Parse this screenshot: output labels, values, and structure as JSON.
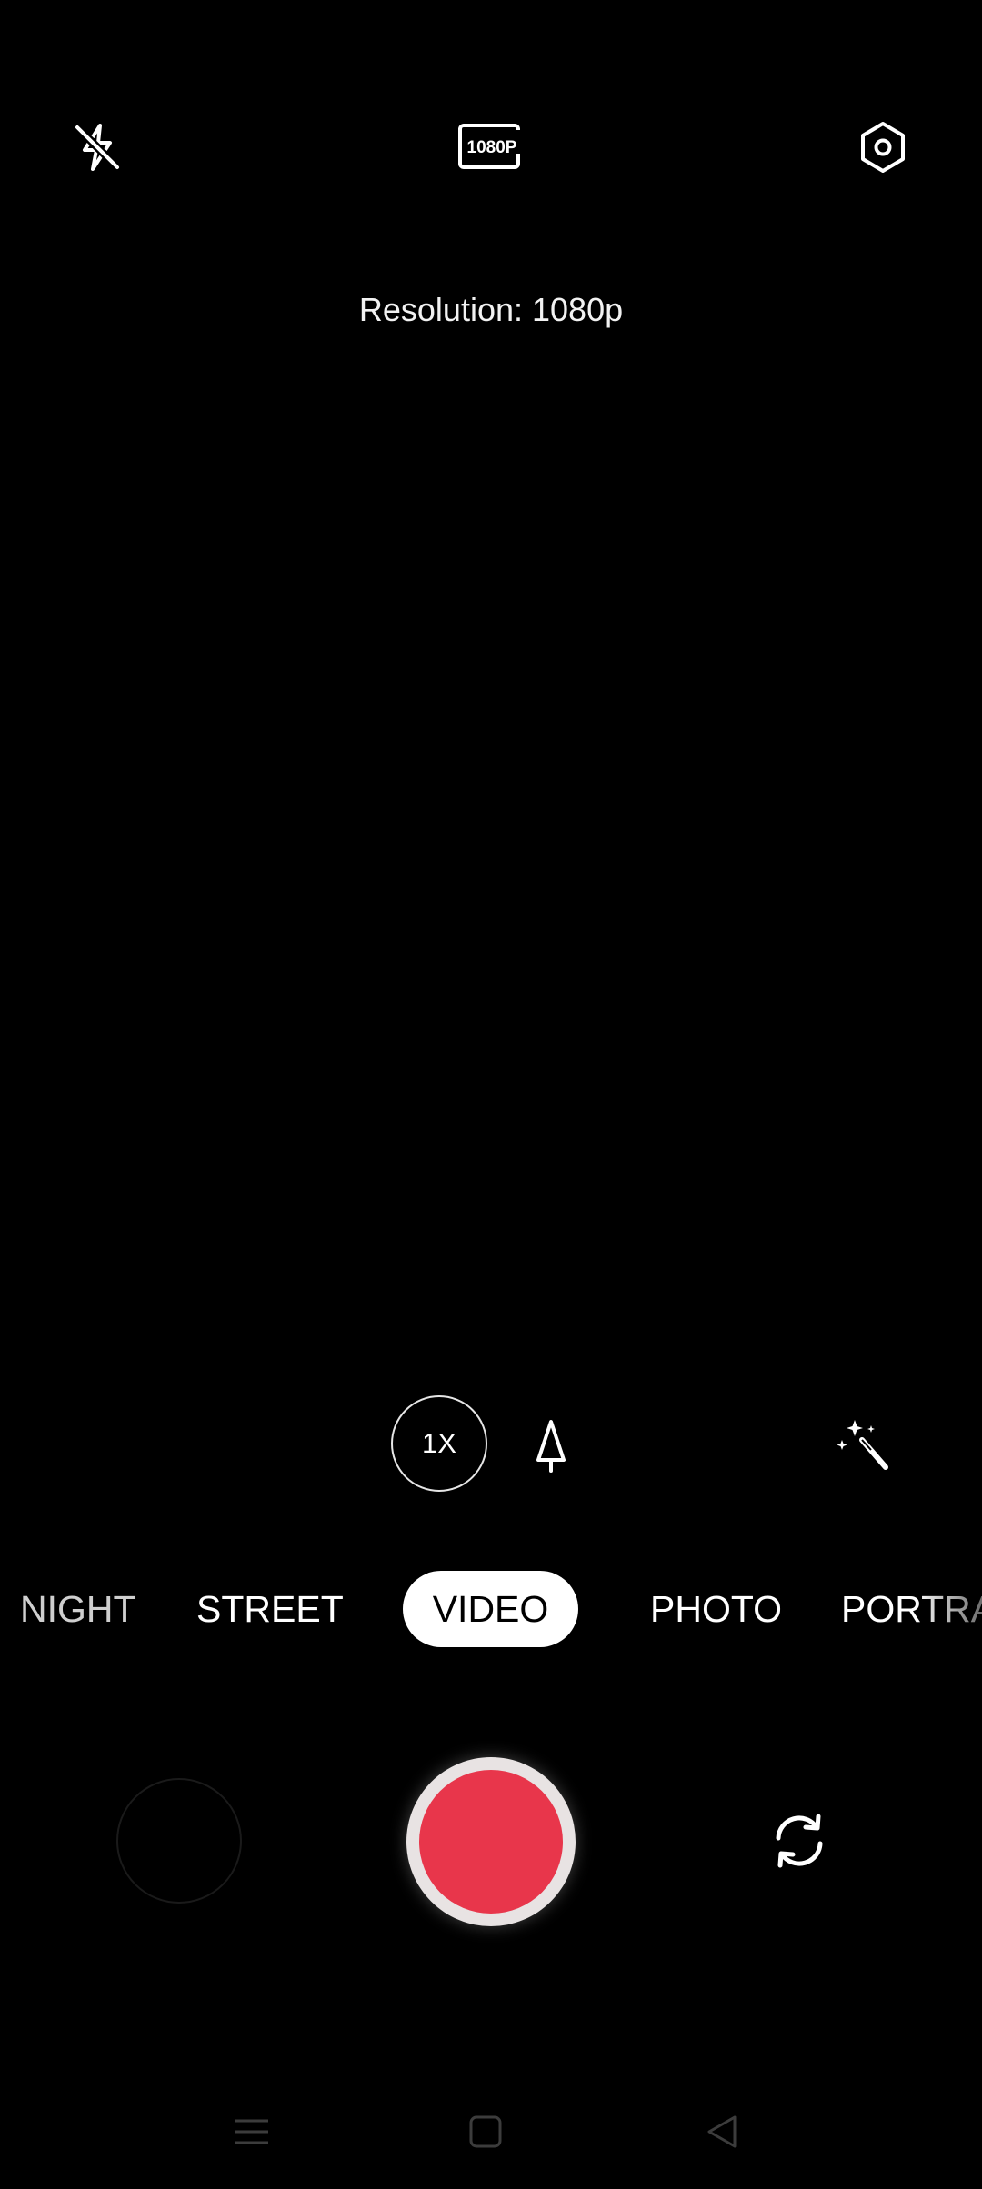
{
  "top_bar": {
    "flash_icon": "flash-off-icon",
    "resolution_badge": "1080P",
    "settings_icon": "settings-hexagon-icon"
  },
  "toast": {
    "resolution_text": "Resolution: 1080p"
  },
  "controls": {
    "zoom_label": "1X",
    "tree_icon": "tree-icon",
    "magic_icon": "magic-wand-icon"
  },
  "modes": {
    "items": [
      "NIGHT",
      "STREET",
      "VIDEO",
      "PHOTO",
      "PORTRAIT"
    ],
    "selected": "VIDEO"
  },
  "bottom": {
    "record_color": "#e8364b",
    "switch_icon": "switch-camera-icon",
    "gallery_icon": "gallery-thumbnail"
  },
  "nav": {
    "menu_icon": "menu-icon",
    "home_icon": "home-icon",
    "back_icon": "back-icon"
  }
}
